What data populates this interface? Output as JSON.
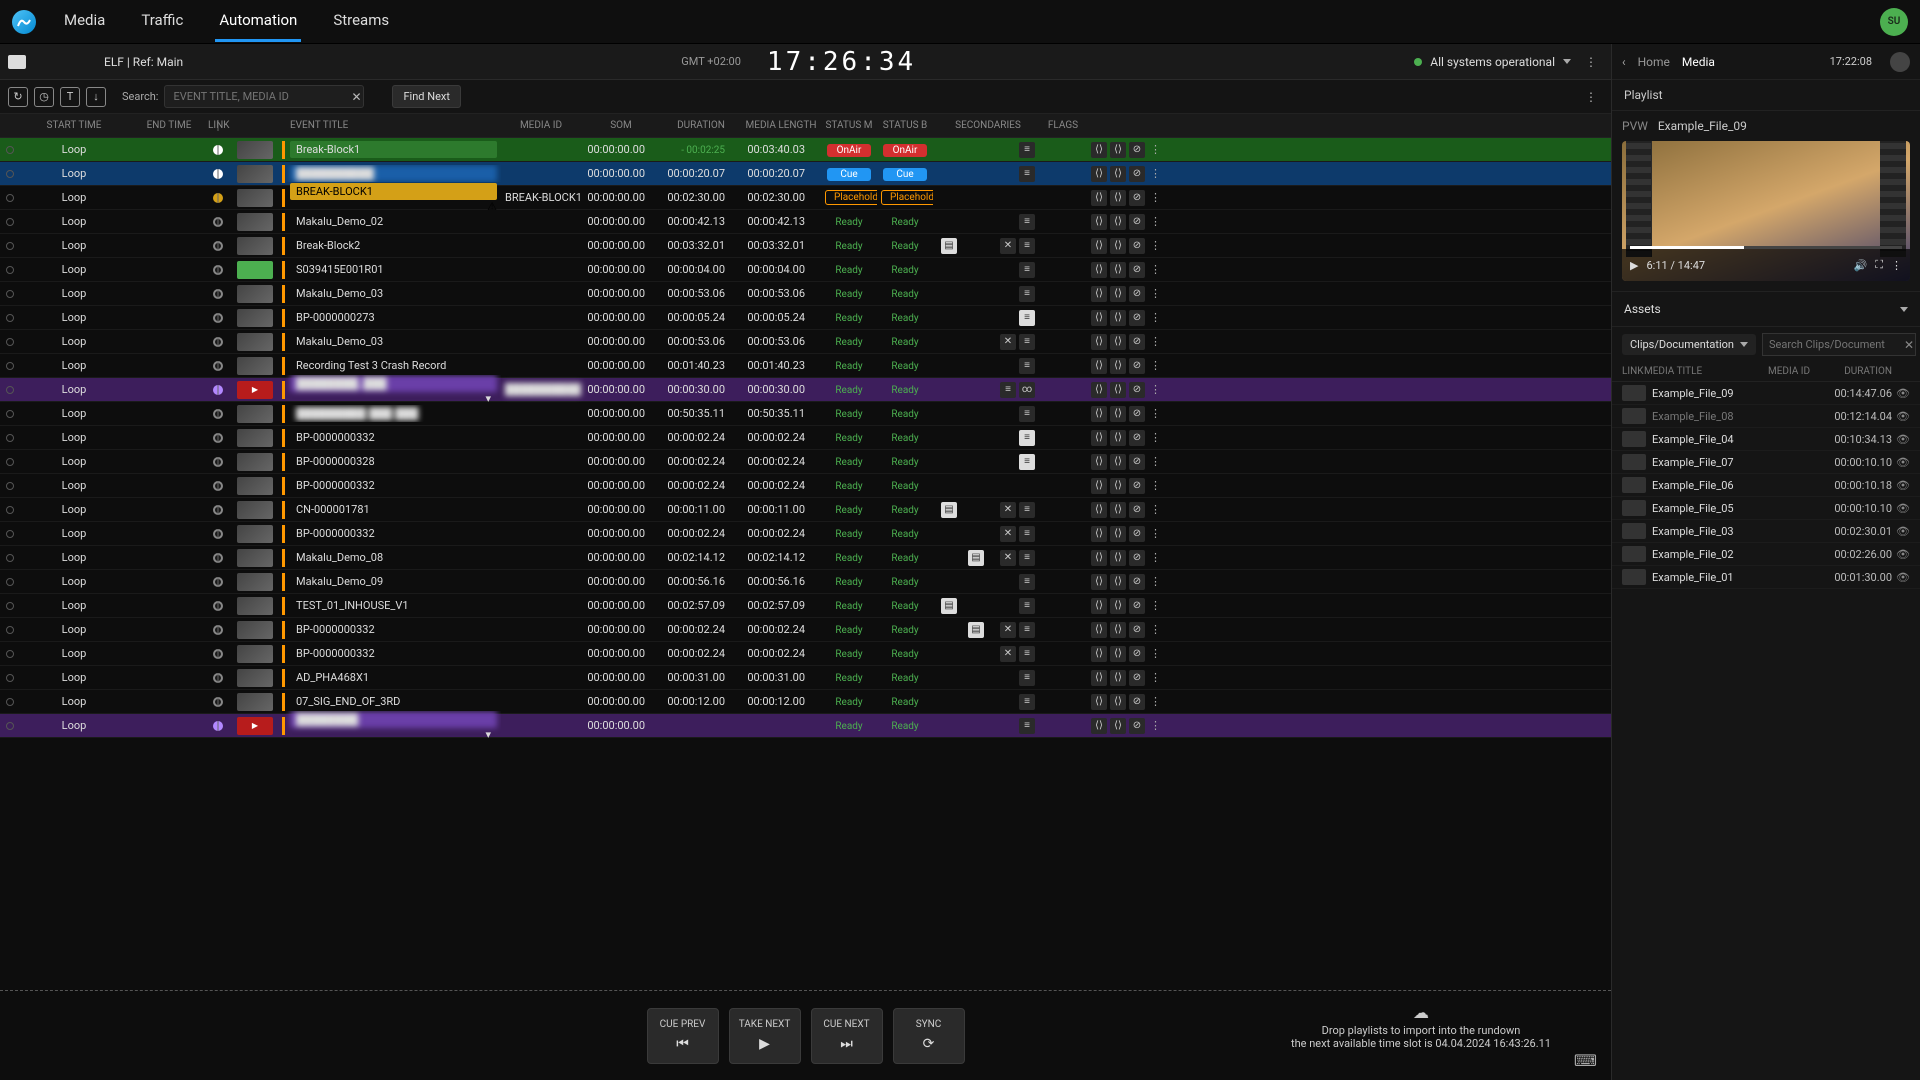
{
  "nav": {
    "items": [
      "Media",
      "Traffic",
      "Automation",
      "Streams"
    ],
    "active": 2,
    "avatar": "SU"
  },
  "context": {
    "title": "ELF | Ref: Main",
    "gmt": "GMT +02:00",
    "clock": "17:26:34",
    "status": "All systems operational"
  },
  "toolbar": {
    "search_label": "Search:",
    "search_placeholder": "EVENT TITLE, MEDIA ID",
    "find_next": "Find Next"
  },
  "columns": {
    "start": "START TIME",
    "end": "END TIME",
    "link": "LINK",
    "title": "EVENT TITLE",
    "mediaid": "MEDIA ID",
    "som": "SOM",
    "duration": "DURATION",
    "length": "MEDIA LENGTH",
    "statm": "STATUS M",
    "statb": "STATUS B",
    "secondaries": "SECONDARIES",
    "flags": "FLAGS"
  },
  "rows": [
    {
      "mode": "onair",
      "start": "Loop",
      "title": "Break-Block1",
      "som": "00:00:00.00",
      "dur": "",
      "len": "00:03:40.03",
      "countdown": "- 00:02:25",
      "sm": "OnAir",
      "sb": "OnAir",
      "sec": [
        "note"
      ],
      "end": [
        "a",
        "b",
        "c"
      ]
    },
    {
      "mode": "cue",
      "start": "Loop",
      "title": "██████████",
      "blur": true,
      "som": "00:00:00.00",
      "dur": "00:00:20.07",
      "len": "00:00:20.07",
      "sm": "Cue",
      "sb": "Cue",
      "sec": [
        "note"
      ],
      "end": [
        "a",
        "b",
        "c"
      ]
    },
    {
      "mode": "placeholder",
      "start": "Loop",
      "title": "BREAK-BLOCK1",
      "mediaid": "BREAK-BLOCK1",
      "som": "00:00:00.00",
      "dur": "00:02:30.00",
      "len": "00:02:30.00",
      "sm": "Placeholder",
      "sb": "Placeholder",
      "warn": true,
      "sec": [],
      "end": [
        "a",
        "b",
        "c"
      ]
    },
    {
      "mode": "",
      "start": "Loop",
      "title": "Makalu_Demo_02",
      "som": "00:00:00.00",
      "dur": "00:00:42.13",
      "len": "00:00:42.13",
      "sm": "Ready",
      "sb": "Ready",
      "sec": [
        "note"
      ],
      "end": [
        "a",
        "b",
        "c"
      ]
    },
    {
      "mode": "",
      "start": "Loop",
      "title": "Break-Block2",
      "som": "00:00:00.00",
      "dur": "00:03:32.01",
      "len": "00:03:32.01",
      "sm": "Ready",
      "sb": "Ready",
      "flag": "doc",
      "sec": [
        "x",
        "note"
      ],
      "end": [
        "a",
        "b",
        "c"
      ]
    },
    {
      "mode": "",
      "start": "Loop",
      "title": "S039415E001R01",
      "thumbclass": "green",
      "som": "00:00:00.00",
      "dur": "00:00:04.00",
      "len": "00:00:04.00",
      "sm": "Ready",
      "sb": "Ready",
      "sec": [
        "note"
      ],
      "end": [
        "a",
        "b",
        "c"
      ]
    },
    {
      "mode": "",
      "start": "Loop",
      "title": "Makalu_Demo_03",
      "som": "00:00:00.00",
      "dur": "00:00:53.06",
      "len": "00:00:53.06",
      "sm": "Ready",
      "sb": "Ready",
      "sec": [
        "note"
      ],
      "end": [
        "a",
        "b",
        "c"
      ]
    },
    {
      "mode": "",
      "start": "Loop",
      "title": "BP-0000000273",
      "som": "00:00:00.00",
      "dur": "00:00:05.24",
      "len": "00:00:05.24",
      "sm": "Ready",
      "sb": "Ready",
      "sec": [
        "light"
      ],
      "end": [
        "a",
        "b",
        "c"
      ]
    },
    {
      "mode": "",
      "start": "Loop",
      "title": "Makalu_Demo_03",
      "som": "00:00:00.00",
      "dur": "00:00:53.06",
      "len": "00:00:53.06",
      "sm": "Ready",
      "sb": "Ready",
      "sec": [
        "x",
        "note"
      ],
      "end": [
        "a",
        "b",
        "c"
      ]
    },
    {
      "mode": "",
      "start": "Loop",
      "title": "Recording Test 3 Crash Record",
      "som": "00:00:00.00",
      "dur": "00:01:40.23",
      "len": "00:01:40.23",
      "sm": "Ready",
      "sb": "Ready",
      "sec": [
        "note"
      ],
      "end": [
        "a",
        "b",
        "c"
      ]
    },
    {
      "mode": "special",
      "start": "Loop",
      "title": "████████_███",
      "blur": true,
      "thumbclass": "live",
      "mediaid": "██████████",
      "midblur": true,
      "som": "00:00:00.00",
      "dur": "00:00:30.00",
      "len": "00:00:30.00",
      "sm": "Ready",
      "sb": "Ready",
      "sec": [
        "note",
        "link"
      ],
      "end": [
        "a",
        "b",
        "c"
      ],
      "dropdown": true
    },
    {
      "mode": "",
      "start": "Loop",
      "title": "█████████ ███ ███",
      "blur": true,
      "som": "00:00:00.00",
      "dur": "00:50:35.11",
      "len": "00:50:35.11",
      "sm": "Ready",
      "sb": "Ready",
      "sec": [
        "note"
      ],
      "end": [
        "a",
        "b",
        "c"
      ]
    },
    {
      "mode": "",
      "start": "Loop",
      "title": "BP-0000000332",
      "som": "00:00:00.00",
      "dur": "00:00:02.24",
      "len": "00:00:02.24",
      "sm": "Ready",
      "sb": "Ready",
      "sec": [
        "light"
      ],
      "end": [
        "a",
        "b",
        "c"
      ]
    },
    {
      "mode": "",
      "start": "Loop",
      "title": "BP-0000000328",
      "som": "00:00:00.00",
      "dur": "00:00:02.24",
      "len": "00:00:02.24",
      "sm": "Ready",
      "sb": "Ready",
      "sec": [
        "light"
      ],
      "end": [
        "a",
        "b",
        "c"
      ]
    },
    {
      "mode": "",
      "start": "Loop",
      "title": "BP-0000000332",
      "som": "00:00:00.00",
      "dur": "00:00:02.24",
      "len": "00:00:02.24",
      "sm": "Ready",
      "sb": "Ready",
      "sec": [],
      "end": [
        "a",
        "b",
        "c"
      ]
    },
    {
      "mode": "",
      "start": "Loop",
      "title": "CN-000001781",
      "som": "00:00:00.00",
      "dur": "00:00:11.00",
      "len": "00:00:11.00",
      "sm": "Ready",
      "sb": "Ready",
      "flag": "doc",
      "sec": [
        "x",
        "note"
      ],
      "end": [
        "a",
        "b",
        "c"
      ]
    },
    {
      "mode": "",
      "start": "Loop",
      "title": "BP-0000000332",
      "som": "00:00:00.00",
      "dur": "00:00:02.24",
      "len": "00:00:02.24",
      "sm": "Ready",
      "sb": "Ready",
      "sec": [
        "x",
        "note"
      ],
      "end": [
        "a",
        "b",
        "c"
      ]
    },
    {
      "mode": "",
      "start": "Loop",
      "title": "Makalu_Demo_08",
      "som": "00:00:00.00",
      "dur": "00:02:14.12",
      "len": "00:02:14.12",
      "sm": "Ready",
      "sb": "Ready",
      "sec": [
        "light"
      ],
      "secgap": true,
      "sec2": [
        "x",
        "note"
      ],
      "end": [
        "a",
        "b",
        "c"
      ]
    },
    {
      "mode": "",
      "start": "Loop",
      "title": "Makalu_Demo_09",
      "som": "00:00:00.00",
      "dur": "00:00:56.16",
      "len": "00:00:56.16",
      "sm": "Ready",
      "sb": "Ready",
      "sec": [
        "note"
      ],
      "end": [
        "a",
        "b",
        "c"
      ]
    },
    {
      "mode": "",
      "start": "Loop",
      "title": "TEST_01_INHOUSE_V1",
      "som": "00:00:00.00",
      "dur": "00:02:57.09",
      "len": "00:02:57.09",
      "sm": "Ready",
      "sb": "Ready",
      "flag": "doc",
      "sec": [
        "note"
      ],
      "end": [
        "a",
        "b",
        "c"
      ]
    },
    {
      "mode": "",
      "start": "Loop",
      "title": "BP-0000000332",
      "som": "00:00:00.00",
      "dur": "00:00:02.24",
      "len": "00:00:02.24",
      "sm": "Ready",
      "sb": "Ready",
      "sec": [
        "light"
      ],
      "secgap": true,
      "sec2": [
        "x",
        "note"
      ],
      "end": [
        "a",
        "b",
        "c"
      ]
    },
    {
      "mode": "",
      "start": "Loop",
      "title": "BP-0000000332",
      "som": "00:00:00.00",
      "dur": "00:00:02.24",
      "len": "00:00:02.24",
      "sm": "Ready",
      "sb": "Ready",
      "sec": [
        "x",
        "note"
      ],
      "end": [
        "a",
        "b",
        "c"
      ]
    },
    {
      "mode": "",
      "start": "Loop",
      "title": "AD_PHA468X1",
      "som": "00:00:00.00",
      "dur": "00:00:31.00",
      "len": "00:00:31.00",
      "sm": "Ready",
      "sb": "Ready",
      "sec": [
        "note"
      ],
      "end": [
        "a",
        "b",
        "c"
      ]
    },
    {
      "mode": "",
      "start": "Loop",
      "title": "07_SIG_END_OF_3RD",
      "som": "00:00:00.00",
      "dur": "00:00:12.00",
      "len": "00:00:12.00",
      "sm": "Ready",
      "sb": "Ready",
      "sec": [
        "note"
      ],
      "end": [
        "a",
        "b",
        "c"
      ]
    },
    {
      "mode": "special",
      "start": "Loop",
      "title": "████████",
      "blur": true,
      "thumbclass": "live",
      "som": "00:00:00.00",
      "dur": "",
      "len": "",
      "sm": "Ready",
      "sb": "Ready",
      "sec": [
        "note"
      ],
      "end": [
        "a",
        "b",
        "c"
      ],
      "dropdown": true
    }
  ],
  "footer": {
    "cue_prev": "CUE PREV",
    "take_next": "TAKE NEXT",
    "cue_next": "CUE NEXT",
    "sync": "SYNC",
    "drop1": "Drop playlists to import into the rundown",
    "drop2": "the next available time slot is 04.04.2024 16:43:26.11"
  },
  "right": {
    "home": "Home",
    "media": "Media",
    "time": "17:22:08",
    "playlist": "Playlist",
    "pvw_label": "PVW",
    "pvw_title": "Example_File_09",
    "preview_time": "6:11 / 14:47",
    "assets": "Assets",
    "filter": "Clips/Documentation",
    "search_placeholder": "Search Clips/Document",
    "cols": {
      "link": "LINK",
      "title": "MEDIA TITLE",
      "mediaid": "MEDIA ID",
      "dur": "DURATION"
    },
    "items": [
      {
        "title": "Example_File_09",
        "dur": "00:14:47.06"
      },
      {
        "title": "Example_File_08",
        "dur": "00:12:14.04",
        "dim": true
      },
      {
        "title": "Example_File_04",
        "dur": "00:10:34.13"
      },
      {
        "title": "Example_File_07",
        "dur": "00:00:10.10"
      },
      {
        "title": "Example_File_06",
        "dur": "00:00:10.18"
      },
      {
        "title": "Example_File_05",
        "dur": "00:00:10.10"
      },
      {
        "title": "Example_File_03",
        "dur": "00:02:30.01"
      },
      {
        "title": "Example_File_02",
        "dur": "00:02:26.00"
      },
      {
        "title": "Example_File_01",
        "dur": "00:01:30.00"
      }
    ]
  }
}
